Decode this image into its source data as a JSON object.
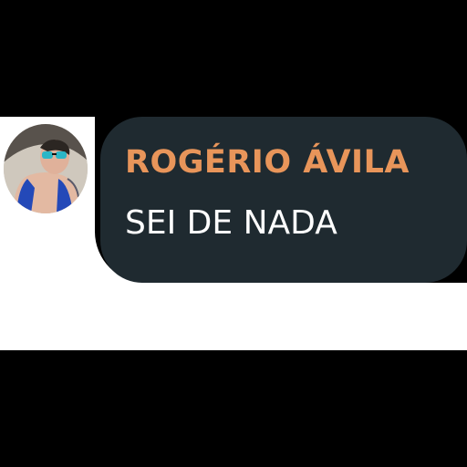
{
  "message": {
    "author_name": "ROGÉRIO ÁVILA",
    "text": "SEI DE NADA",
    "avatar_icon": "user-photo-avatar"
  },
  "colors": {
    "bubble": "#1f2a30",
    "author_name": "#e8955a",
    "text": "#ffffff",
    "background": "#000000"
  }
}
